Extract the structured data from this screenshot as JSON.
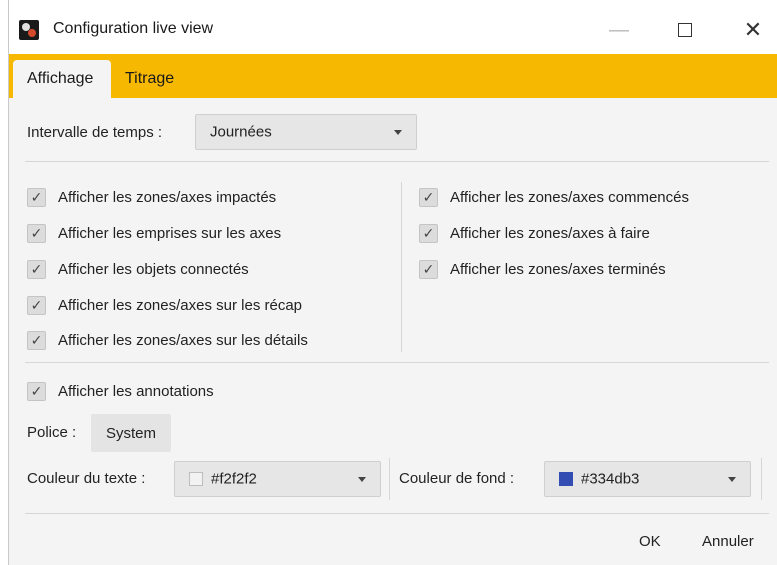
{
  "window": {
    "title": "Configuration live view",
    "minimize_glyph": "—",
    "close_glyph": "✕"
  },
  "tabs": [
    {
      "label": "Affichage",
      "active": true
    },
    {
      "label": "Titrage",
      "active": false
    }
  ],
  "interval": {
    "label": "Intervalle de temps :",
    "value": "Journées"
  },
  "checkboxes_left": [
    {
      "label": "Afficher les zones/axes impactés",
      "checked": true
    },
    {
      "label": "Afficher les emprises sur les axes",
      "checked": true
    },
    {
      "label": "Afficher les objets connectés",
      "checked": true
    },
    {
      "label": "Afficher les zones/axes sur les récap",
      "checked": true
    },
    {
      "label": "Afficher les zones/axes sur les détails",
      "checked": true
    }
  ],
  "checkboxes_right": [
    {
      "label": "Afficher les zones/axes commencés",
      "checked": true
    },
    {
      "label": "Afficher les zones/axes à faire",
      "checked": true
    },
    {
      "label": "Afficher les zones/axes terminés",
      "checked": true
    }
  ],
  "annotations": {
    "label": "Afficher les annotations",
    "checked": true
  },
  "check_glyph": "✓",
  "font": {
    "label": "Police :",
    "value": "System"
  },
  "text_color": {
    "label": "Couleur du texte :",
    "value": "#f2f2f2",
    "swatch": "#f2f2f2"
  },
  "background_color": {
    "label": "Couleur de fond :",
    "value": "#334db3",
    "swatch": "#334db3"
  },
  "buttons": {
    "ok": "OK",
    "cancel": "Annuler"
  },
  "colors": {
    "accent": "#f6b800",
    "panel": "#f4f4f4"
  }
}
